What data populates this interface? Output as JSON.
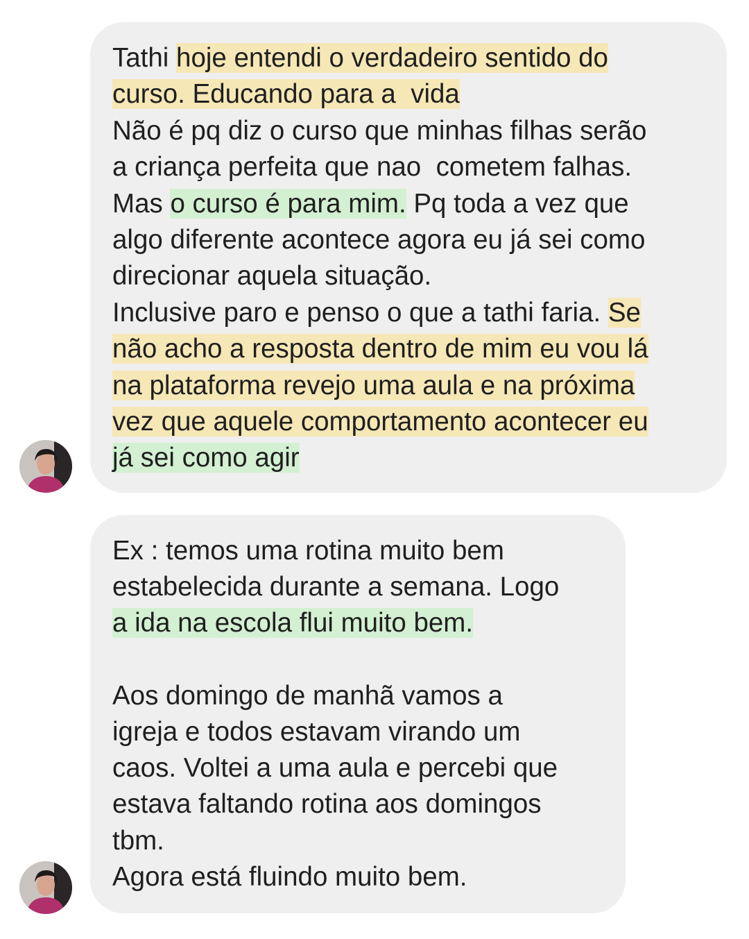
{
  "messages": [
    {
      "sender_avatar": "avatar-user",
      "lines": [
        [
          {
            "t": "Tathi "
          },
          {
            "t": "hoje entendi o verdadeiro sentido do",
            "h": "yellow"
          }
        ],
        [
          {
            "t": "curso. Educando para a  vida",
            "h": "yellow"
          }
        ],
        [
          {
            "t": "Não é pq diz o curso que minhas filhas serão"
          }
        ],
        [
          {
            "t": "a criança perfeita que nao  cometem falhas."
          }
        ],
        [
          {
            "t": "Mas "
          },
          {
            "t": "o curso é para mim.",
            "h": "green"
          },
          {
            "t": " Pq toda a vez que"
          }
        ],
        [
          {
            "t": "algo diferente acontece agora eu já sei como"
          }
        ],
        [
          {
            "t": "direcionar aquela situação."
          }
        ],
        [
          {
            "t": "Inclusive paro e penso o que a tathi faria. "
          },
          {
            "t": "Se",
            "h": "yellow"
          }
        ],
        [
          {
            "t": "não acho a resposta dentro de mim eu vou lá",
            "h": "yellow"
          }
        ],
        [
          {
            "t": "na plataforma revejo uma aula e na próxima",
            "h": "yellow"
          }
        ],
        [
          {
            "t": "vez que aquele comportamento acontecer eu",
            "h": "yellow"
          }
        ],
        [
          {
            "t": "já sei como agir",
            "h": "green"
          }
        ]
      ]
    },
    {
      "sender_avatar": "avatar-user",
      "lines": [
        [
          {
            "t": "Ex : temos uma rotina muito bem"
          }
        ],
        [
          {
            "t": "estabelecida durante a semana. Logo"
          }
        ],
        [
          {
            "t": "a ida na escola flui muito bem.",
            "h": "green"
          }
        ],
        [
          {
            "t": ""
          }
        ],
        [
          {
            "t": "Aos domingo de manhã vamos a"
          }
        ],
        [
          {
            "t": "igreja e todos estavam virando um"
          }
        ],
        [
          {
            "t": "caos. Voltei a uma aula e percebi que"
          }
        ],
        [
          {
            "t": "estava faltando rotina aos domingos"
          }
        ],
        [
          {
            "t": "tbm."
          }
        ],
        [
          {
            "t": "Agora está fluindo muito bem."
          }
        ]
      ]
    }
  ],
  "colors": {
    "bubble": "#efefef",
    "highlight_yellow": "#f6e7b6",
    "highlight_green": "#d4f0d2",
    "text": "#1f1f1f"
  }
}
